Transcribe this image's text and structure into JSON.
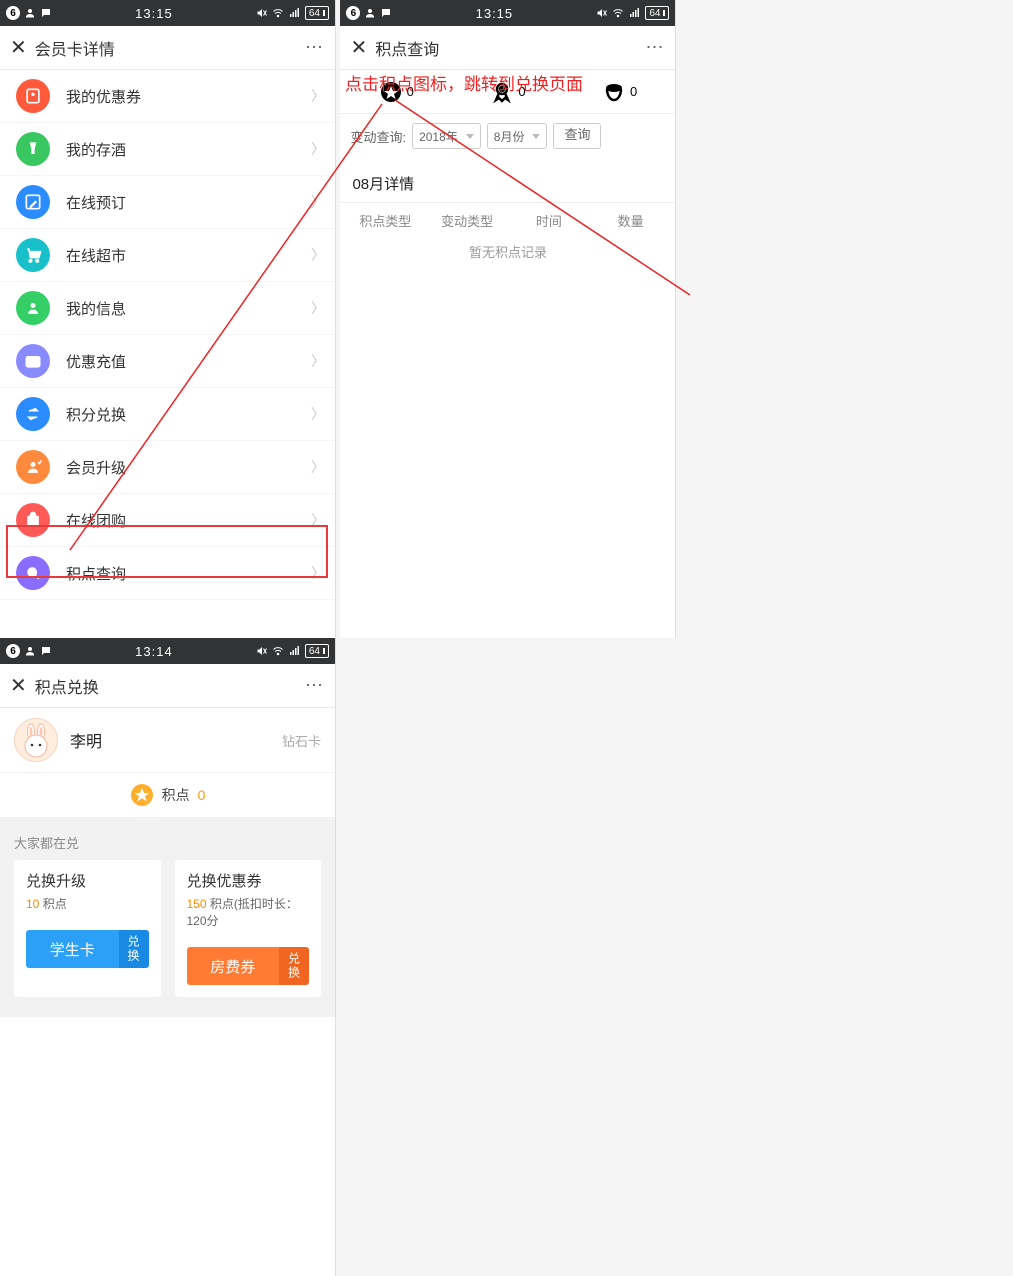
{
  "status": {
    "notif": "6",
    "time1": "13:15",
    "time2": "13:15",
    "time3": "13:14",
    "battery": "64"
  },
  "panel1": {
    "title": "会员卡详情",
    "items": [
      {
        "label": "我的优惠券",
        "color": "#ff5a3c"
      },
      {
        "label": "我的存酒",
        "color": "#38c760"
      },
      {
        "label": "在线预订",
        "color": "#2a8cff"
      },
      {
        "label": "在线超市",
        "color": "#18c1c9"
      },
      {
        "label": "我的信息",
        "color": "#35cf67"
      },
      {
        "label": "优惠充值",
        "color": "#8a8aff"
      },
      {
        "label": "积分兑换",
        "color": "#2a8cff"
      },
      {
        "label": "会员升级",
        "color": "#ff8a3d"
      },
      {
        "label": "在线团购",
        "color": "#ff5a57"
      },
      {
        "label": "积点查询",
        "color": "#8a6cff"
      }
    ]
  },
  "panel2": {
    "title": "积点查询",
    "tab_vals": [
      "0",
      "0",
      "0"
    ],
    "filter_label": "变动查询:",
    "year": "2018年",
    "month": "8月份",
    "query": "查询",
    "section": "08月详情",
    "cols": [
      "积点类型",
      "变动类型",
      "时间",
      "数量"
    ],
    "empty": "暂无积点记录"
  },
  "panel3": {
    "title": "积点兑换",
    "user": "李明",
    "level": "钻石卡",
    "points_label": "积点",
    "points_val": "0",
    "sechead": "大家都在兑",
    "cards": [
      {
        "title": "兑换升级",
        "cost": "10",
        "cost_suffix": " 积点",
        "extra": "",
        "btn": "学生卡",
        "side": "兑换"
      },
      {
        "title": "兑换优惠券",
        "cost": "150",
        "cost_suffix": " 积点",
        "extra": "(抵扣时长：120分",
        "btn": "房费券",
        "side": "兑换"
      }
    ]
  },
  "annotation": "点击积点图标，跳转到兑换页面",
  "chevron": "〉",
  "close": "✕",
  "more": "⋯"
}
